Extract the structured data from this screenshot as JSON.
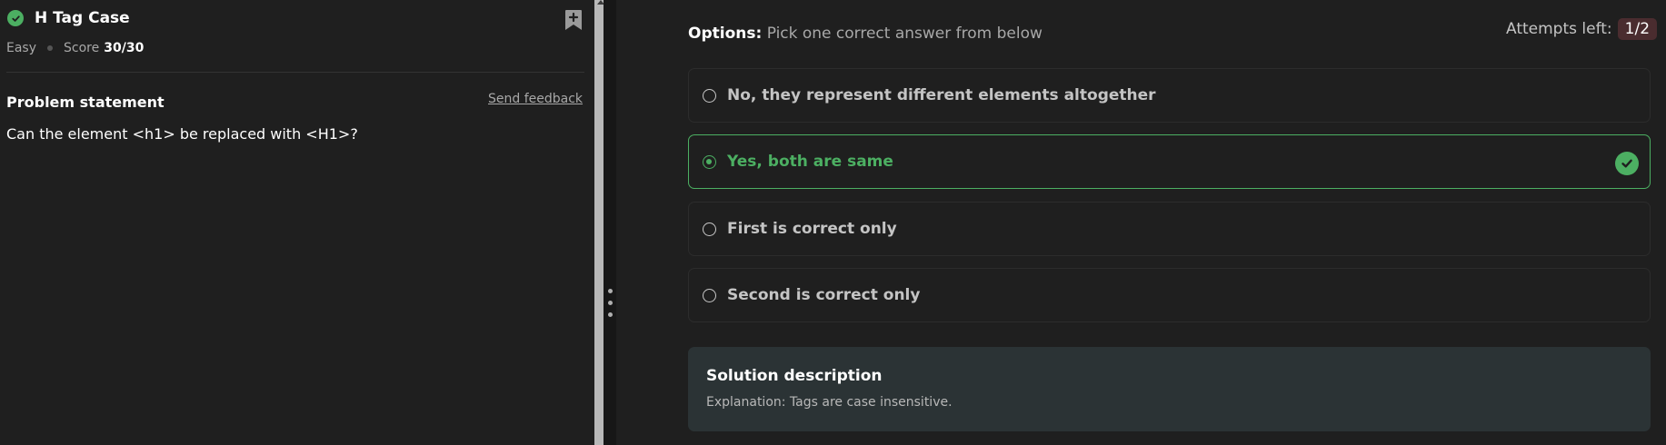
{
  "problem": {
    "title": "H Tag Case",
    "difficulty": "Easy",
    "score_label": "Score",
    "score_value": "30/30",
    "statement_heading": "Problem statement",
    "feedback_link": "Send feedback",
    "statement_text": "Can the element <h1> be replaced with <H1>?"
  },
  "quiz": {
    "options_label": "Options:",
    "options_hint": "Pick one correct answer from below",
    "attempts_label": "Attempts left:",
    "attempts_value": "1/2",
    "options": [
      {
        "label": "No, they represent different elements altogether",
        "selected": false
      },
      {
        "label": "Yes, both are same",
        "selected": true
      },
      {
        "label": "First is correct only",
        "selected": false
      },
      {
        "label": "Second is correct only",
        "selected": false
      }
    ]
  },
  "solution": {
    "heading": "Solution description",
    "text": "Explanation: Tags are case insensitive."
  },
  "colors": {
    "success": "#4caf62",
    "background": "#1f1f1f",
    "solution_bg": "#2b3335"
  }
}
